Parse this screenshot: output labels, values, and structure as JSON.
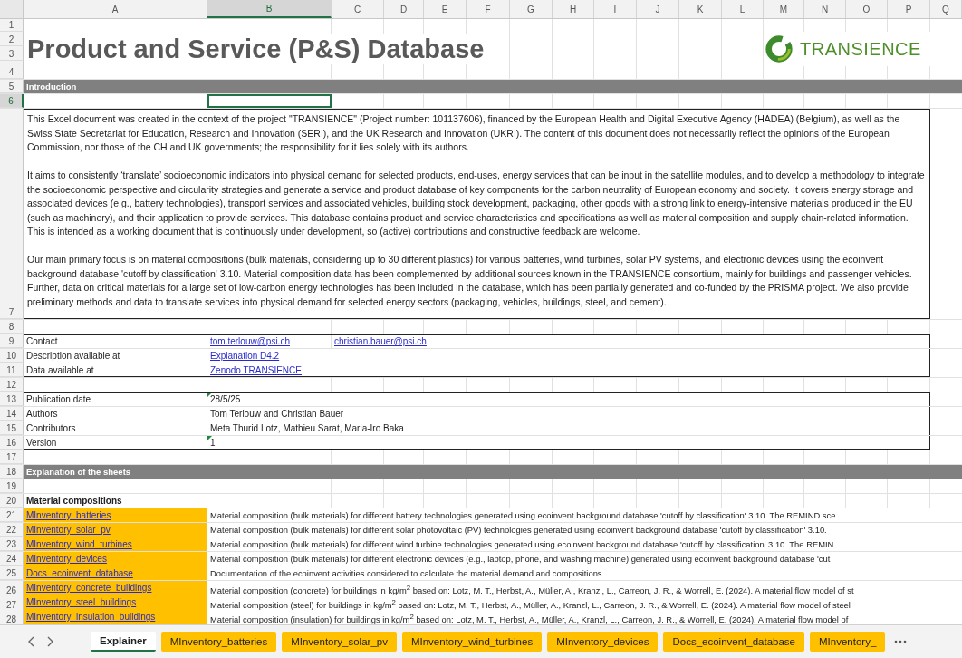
{
  "columns": [
    {
      "label": "A",
      "selected": false
    },
    {
      "label": "B",
      "selected": true
    },
    {
      "label": "C",
      "selected": false
    },
    {
      "label": "D",
      "selected": false
    },
    {
      "label": "E",
      "selected": false
    },
    {
      "label": "F",
      "selected": false
    },
    {
      "label": "G",
      "selected": false
    },
    {
      "label": "H",
      "selected": false
    },
    {
      "label": "I",
      "selected": false
    },
    {
      "label": "J",
      "selected": false
    },
    {
      "label": "K",
      "selected": false
    },
    {
      "label": "L",
      "selected": false
    },
    {
      "label": "M",
      "selected": false
    },
    {
      "label": "N",
      "selected": false
    },
    {
      "label": "O",
      "selected": false
    },
    {
      "label": "P",
      "selected": false
    },
    {
      "label": "Q",
      "selected": false
    }
  ],
  "header": {
    "rows": [
      {
        "number": "1",
        "selected": false
      },
      {
        "number": "2",
        "selected": false
      },
      {
        "number": "3",
        "selected": false
      },
      {
        "number": "4",
        "selected": false
      }
    ],
    "title": "Product and Service (P&S) Database",
    "logo_text": "TRANSIENCE"
  },
  "rows": [
    {
      "number": "5",
      "selected": false,
      "kind": "section",
      "label": "Introduction"
    },
    {
      "number": "6",
      "selected": true,
      "kind": "blank"
    },
    {
      "number": "7",
      "selected": false,
      "kind": "text",
      "paragraphs": [
        "This Excel document was created in the context of the project \"TRANSIENCE\" (Project number: 101137606), financed by the European Health and Digital Executive Agency (HADEA) (Belgium), as well as the Swiss State Secretariat for Education, Research and Innovation (SERI), and the UK Research and Innovation (UKRI). The content of this document does not necessarily reflect the opinions of the European Commission, nor those of the CH and UK governments; the responsibility for it lies solely with its authors.",
        "It aims to consistently ‘translate’ socioeconomic indicators into physical demand for selected products, end-uses, energy services that can be input in the satellite modules, and to develop a methodology to integrate the socioeconomic perspective and circularity strategies and generate a service and product database of key components for the carbon neutrality of European economy and society. It covers energy storage and associated devices (e.g., battery technologies), transport services and associated vehicles, building stock development, packaging, other goods with a strong link to energy-intensive materials produced in the EU (such as machinery), and their application to provide services. This database contains product and service characteristics and specifications as well as material composition and supply chain-related information. This is intended as a working document that is continuously under development, so (active) contributions and constructive feedback are welcome.",
        "Our main primary focus is on material compositions (bulk materials, considering up to 30 different plastics) for various batteries, wind turbines, solar PV systems, and electronic devices using the ecoinvent background database 'cutoff by classification' 3.10. Material composition data has been complemented by additional sources known in the TRANSIENCE consortium, mainly for buildings and passenger vehicles. Further, data on critical materials for a large set of low-carbon energy technologies has been included in the database, which has been partially generated and co-funded by the PRISMA project. We also provide preliminary methods and data to translate services into physical demand for selected energy sectors (packaging, vehicles, buildings, steel, and cement)."
      ]
    },
    {
      "number": "8",
      "selected": false,
      "kind": "blank"
    },
    {
      "number": "9",
      "selected": false,
      "kind": "field",
      "label": "Contact",
      "flagged": false,
      "values": [
        {
          "text": "tom.terlouw@psi.ch",
          "link": true
        },
        {
          "text": "christian.bauer@psi.ch",
          "link": true
        }
      ]
    },
    {
      "number": "10",
      "selected": false,
      "kind": "field",
      "label": "Description available at",
      "flagged": false,
      "values": [
        {
          "text": "Explanation D4.2",
          "link": true
        }
      ]
    },
    {
      "number": "11",
      "selected": false,
      "kind": "field",
      "label": "Data available at",
      "flagged": false,
      "values": [
        {
          "text": "Zenodo TRANSIENCE",
          "link": true
        }
      ]
    },
    {
      "number": "12",
      "selected": false,
      "kind": "blank"
    },
    {
      "number": "13",
      "selected": false,
      "kind": "field",
      "label": "Publication date",
      "flagged": true,
      "values": [
        {
          "text": "28/5/25",
          "link": false
        }
      ]
    },
    {
      "number": "14",
      "selected": false,
      "kind": "field",
      "label": "Authors",
      "flagged": false,
      "values": [
        {
          "text": "Tom Terlouw and Christian Bauer",
          "link": false
        }
      ]
    },
    {
      "number": "15",
      "selected": false,
      "kind": "field",
      "label": "Contributors",
      "flagged": false,
      "values": [
        {
          "text": "Meta Thurid Lotz, Mathieu Sarat, Maria-Iro Baka",
          "link": false
        }
      ]
    },
    {
      "number": "16",
      "selected": false,
      "kind": "field",
      "label": "Version",
      "flagged": true,
      "values": [
        {
          "text": "1",
          "link": false
        }
      ]
    },
    {
      "number": "17",
      "selected": false,
      "kind": "blank"
    },
    {
      "number": "18",
      "selected": false,
      "kind": "section",
      "label": "Explanation of the sheets"
    },
    {
      "number": "19",
      "selected": false,
      "kind": "blank"
    },
    {
      "number": "20",
      "selected": false,
      "kind": "heading",
      "label": "Material compositions"
    },
    {
      "number": "21",
      "selected": false,
      "kind": "sheet",
      "link": "MInventory_batteries",
      "description": "Material composition (bulk materials) for different battery technologies generated using ecoinvent background database 'cutoff by classification' 3.10. The REMIND sce"
    },
    {
      "number": "22",
      "selected": false,
      "kind": "sheet",
      "link": "MInventory_solar_pv",
      "description": "Material composition (bulk materials) for different solar photovoltaic (PV) technologies generated using ecoinvent background database 'cutoff by classification' 3.10."
    },
    {
      "number": "23",
      "selected": false,
      "kind": "sheet",
      "link": "MInventory_wind_turbines",
      "description": "Material composition (bulk materials) for different wind turbine technologies generated using ecoinvent background database 'cutoff by classification' 3.10. The REMIN"
    },
    {
      "number": "24",
      "selected": false,
      "kind": "sheet",
      "link": "MInventory_devices",
      "description": "Material composition (bulk materials) for different electronic devices (e.g., laptop, phone, and washing machine) generated using ecoinvent background database 'cut"
    },
    {
      "number": "25",
      "selected": false,
      "kind": "sheet",
      "link": "Docs_ecoinvent_database",
      "description": "Documentation of the ecoinvent activities considered to calculate the material demand and compositions."
    },
    {
      "number": "26",
      "selected": false,
      "kind": "sheet",
      "link": "MInventory_concrete_buildings",
      "description": "Material composition (concrete) for buildings in kg/m$^{2}$ based on: Lotz, M. T., Herbst, A., Müller, A., Kranzl, L., Carreon, J. R., & Worrell, E. (2024). A material flow model of st"
    },
    {
      "number": "27",
      "selected": false,
      "kind": "sheet",
      "link": "MInventory_steel_buildings",
      "description": "Material composition (steel) for buildings in kg/m$^{2}$ based on: Lotz, M. T., Herbst, A., Müller, A., Kranzl, L., Carreon, J. R., & Worrell, E. (2024). A material flow model of steel"
    },
    {
      "number": "28",
      "selected": false,
      "kind": "sheet",
      "link": "MInventory_insulation_buildings",
      "description": "Material composition (insulation) for buildings in kg/m$^{2}$ based on: Lotz, M. T., Herbst, A., Müller, A., Kranzl, L., Carreon, J. R., & Worrell, E. (2024). A material flow model of"
    }
  ],
  "sheet_tabs": [
    {
      "label": "Explainer",
      "selected": true
    },
    {
      "label": "MInventory_batteries",
      "selected": false
    },
    {
      "label": "MInventory_solar_pv",
      "selected": false
    },
    {
      "label": "MInventory_wind_turbines",
      "selected": false
    },
    {
      "label": "MInventory_devices",
      "selected": false
    },
    {
      "label": "Docs_ecoinvent_database",
      "selected": false
    },
    {
      "label": "MInventory_",
      "selected": false
    }
  ]
}
